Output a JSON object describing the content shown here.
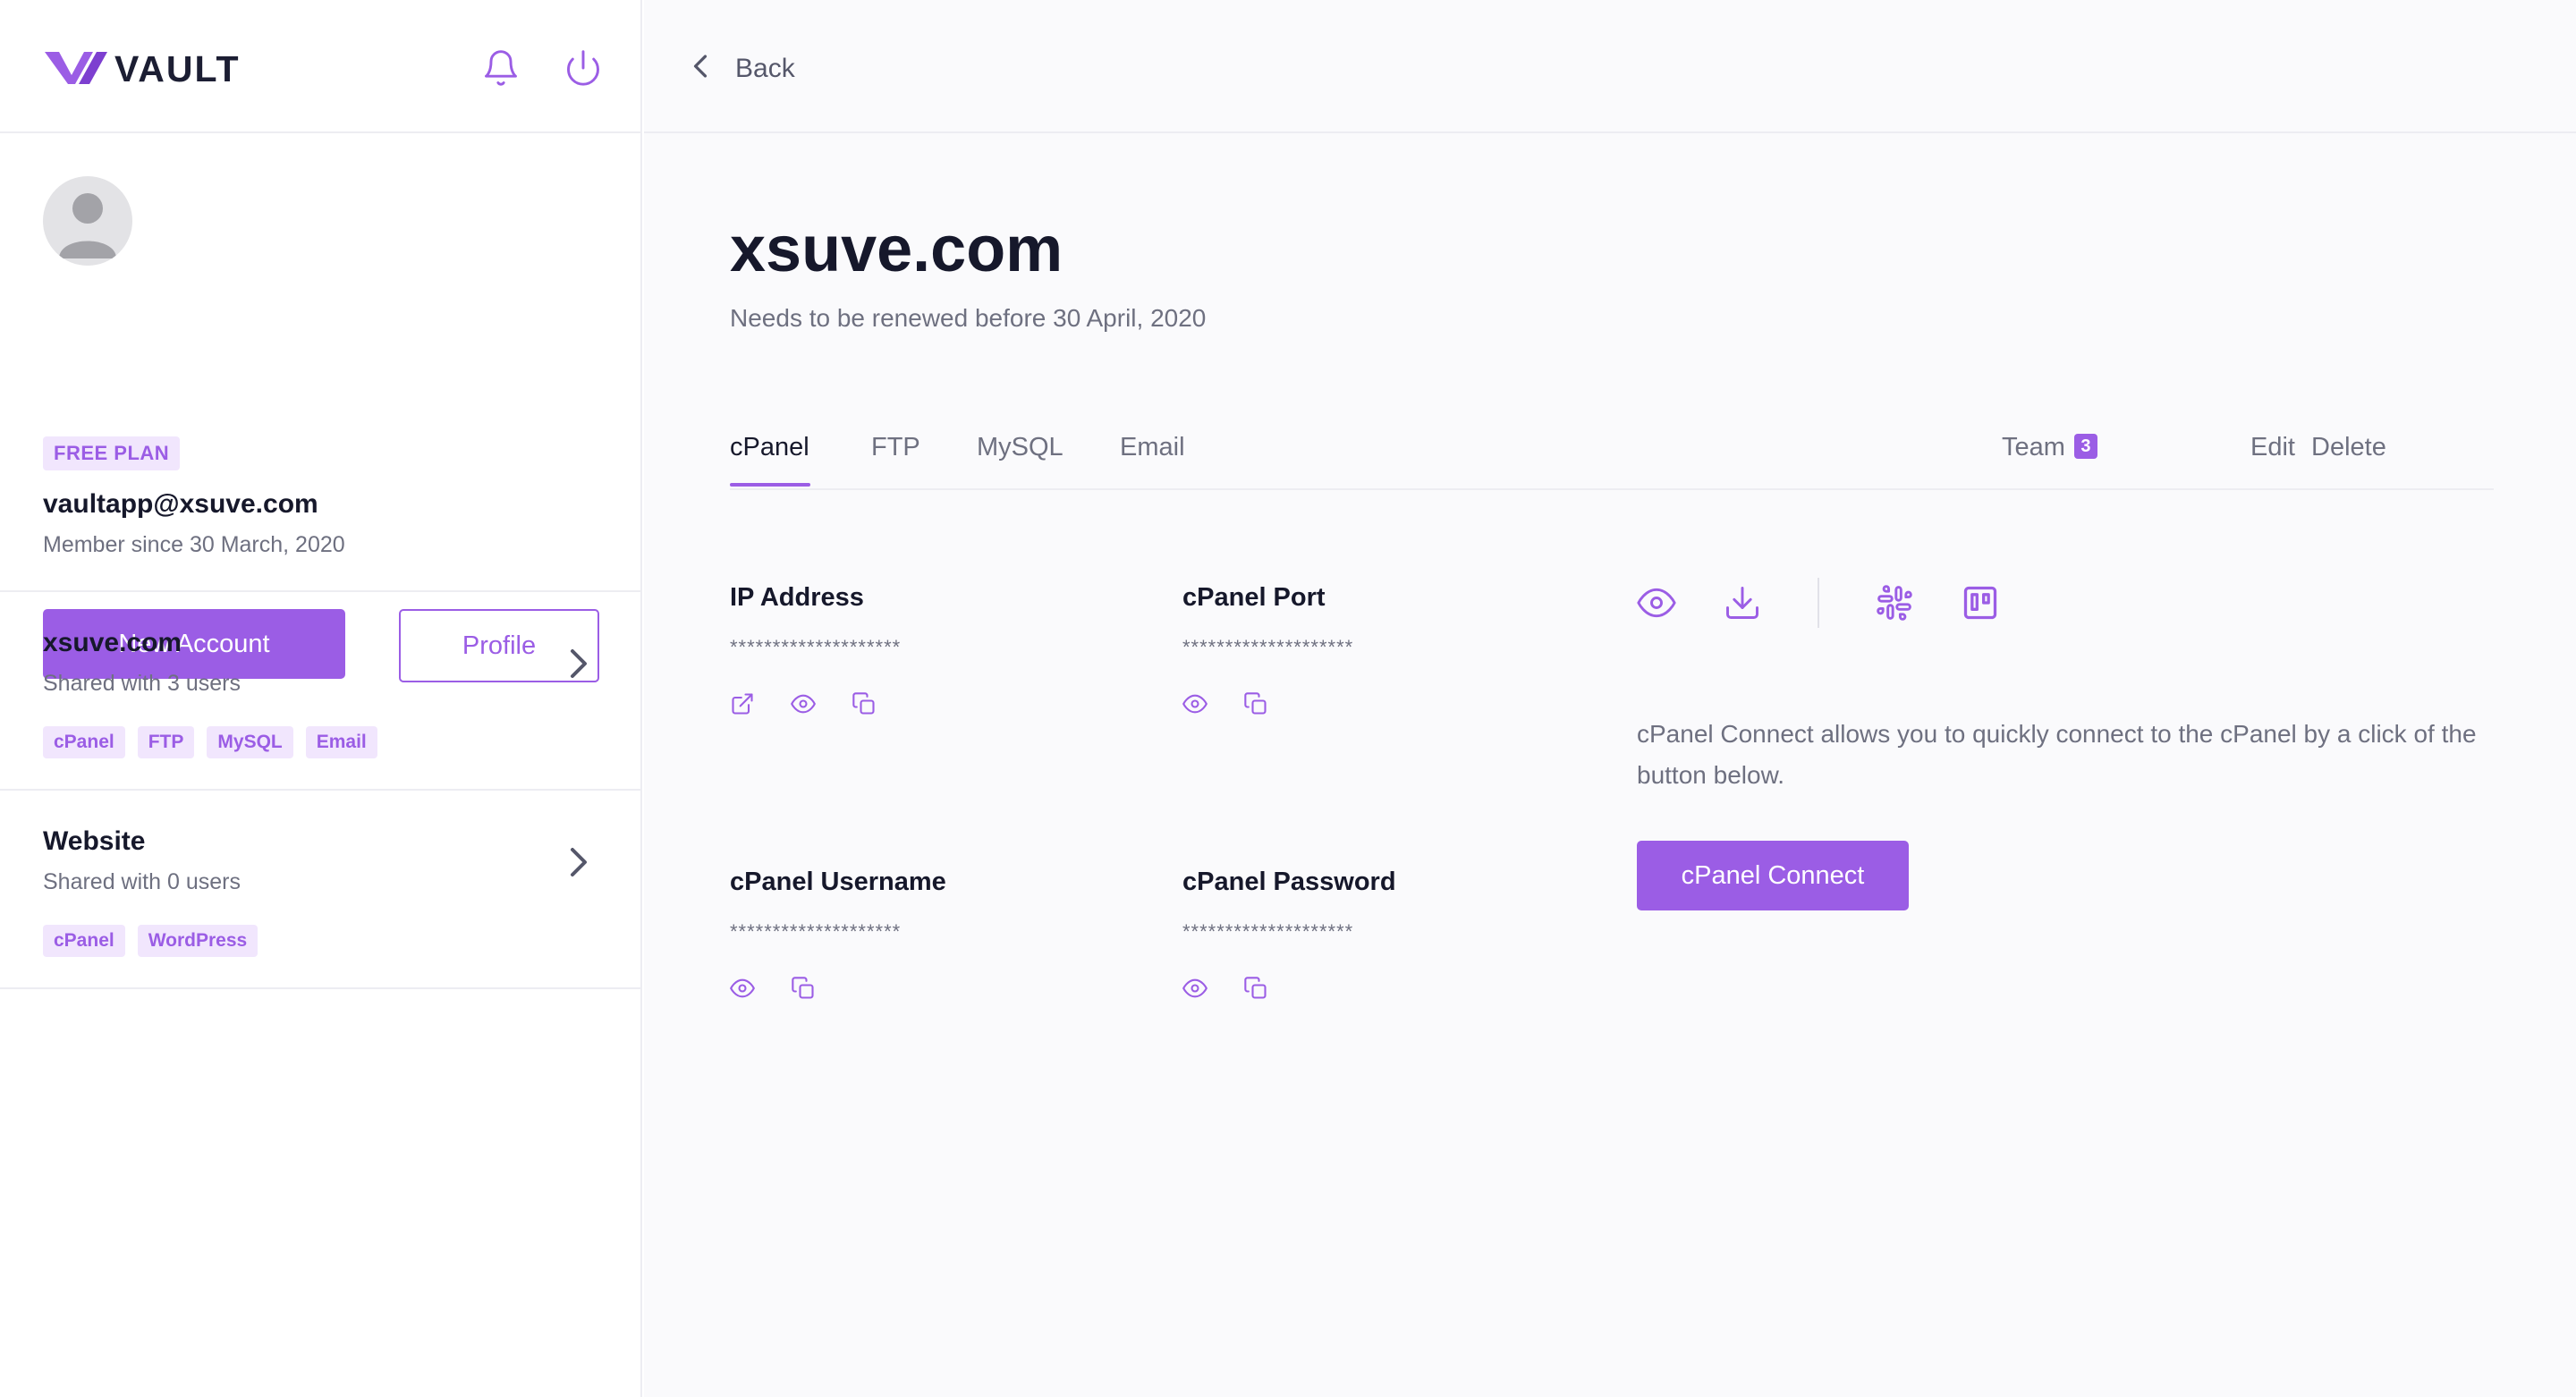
{
  "app": {
    "name": "VAULT"
  },
  "colors": {
    "accent": "#9b5de5",
    "text": "#16182b",
    "muted": "#6e7080"
  },
  "header_icons": [
    "bell-icon",
    "power-icon"
  ],
  "profile": {
    "plan": "FREE PLAN",
    "email": "vaultapp@xsuve.com",
    "member_since": "Member since 30 March, 2020",
    "new_account_label": "New Account",
    "profile_label": "Profile"
  },
  "accounts": [
    {
      "name": "xsuve.com",
      "shared": "Shared with 3 users",
      "tags": [
        "cPanel",
        "FTP",
        "MySQL",
        "Email"
      ]
    },
    {
      "name": "Website",
      "shared": "Shared with 0 users",
      "tags": [
        "cPanel",
        "WordPress"
      ]
    }
  ],
  "main": {
    "back_label": "Back",
    "title": "xsuve.com",
    "subtitle": "Needs to be renewed before 30 April, 2020",
    "tabs": [
      {
        "label": "cPanel",
        "active": true
      },
      {
        "label": "FTP"
      },
      {
        "label": "MySQL"
      },
      {
        "label": "Email"
      }
    ],
    "team_label": "Team",
    "team_count": "3",
    "edit_label": "Edit",
    "delete_label": "Delete",
    "fields": [
      {
        "label": "IP Address",
        "value": "********************",
        "icons": [
          "external-link-icon",
          "eye-icon",
          "copy-icon"
        ]
      },
      {
        "label": "cPanel Port",
        "value": "********************",
        "icons": [
          "eye-icon",
          "copy-icon"
        ]
      },
      {
        "label": "cPanel Username",
        "value": "********************",
        "icons": [
          "eye-icon",
          "copy-icon"
        ]
      },
      {
        "label": "cPanel Password",
        "value": "********************",
        "icons": [
          "eye-icon",
          "copy-icon"
        ]
      }
    ],
    "action_icons": [
      "eye-icon",
      "download-icon",
      "slack-icon",
      "trello-icon"
    ],
    "connect_description": "cPanel Connect allows you to quickly connect to the cPanel by a click of the button below.",
    "connect_label": "cPanel Connect"
  }
}
